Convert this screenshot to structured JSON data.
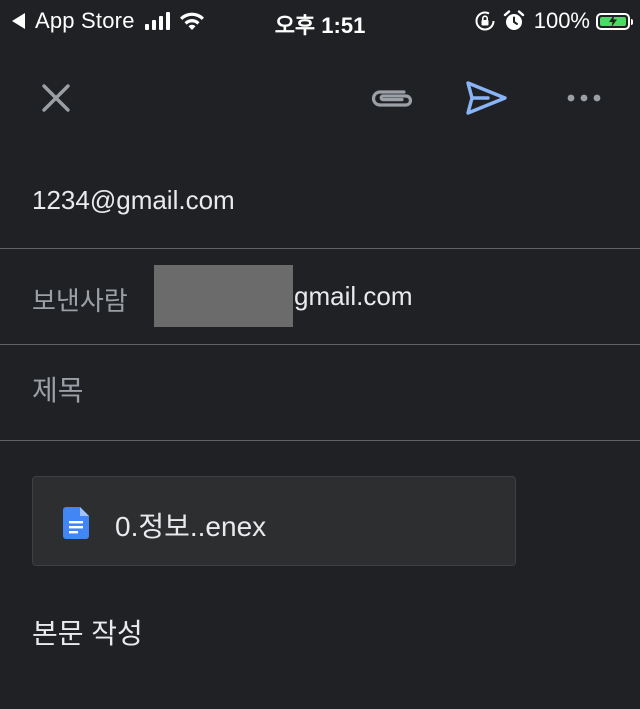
{
  "status_bar": {
    "back_app": "App Store",
    "time": "오후 1:51",
    "battery_percent": "100%",
    "battery_level": 1.0,
    "signal_bars": 4
  },
  "toolbar": {
    "close_icon": "close-icon",
    "attach_icon": "paperclip-icon",
    "send_icon": "send-icon",
    "more_icon": "more-horizontal-icon",
    "send_color": "#8ab4f8"
  },
  "compose": {
    "to": "1234@gmail.com",
    "from_label": "보낸사람",
    "from_value": "gmail.com",
    "subject_placeholder": "제목",
    "attachment": {
      "icon": "google-docs-icon",
      "icon_color": "#4285f4",
      "name": "0.정보..enex"
    },
    "body_placeholder": "본문 작성"
  }
}
